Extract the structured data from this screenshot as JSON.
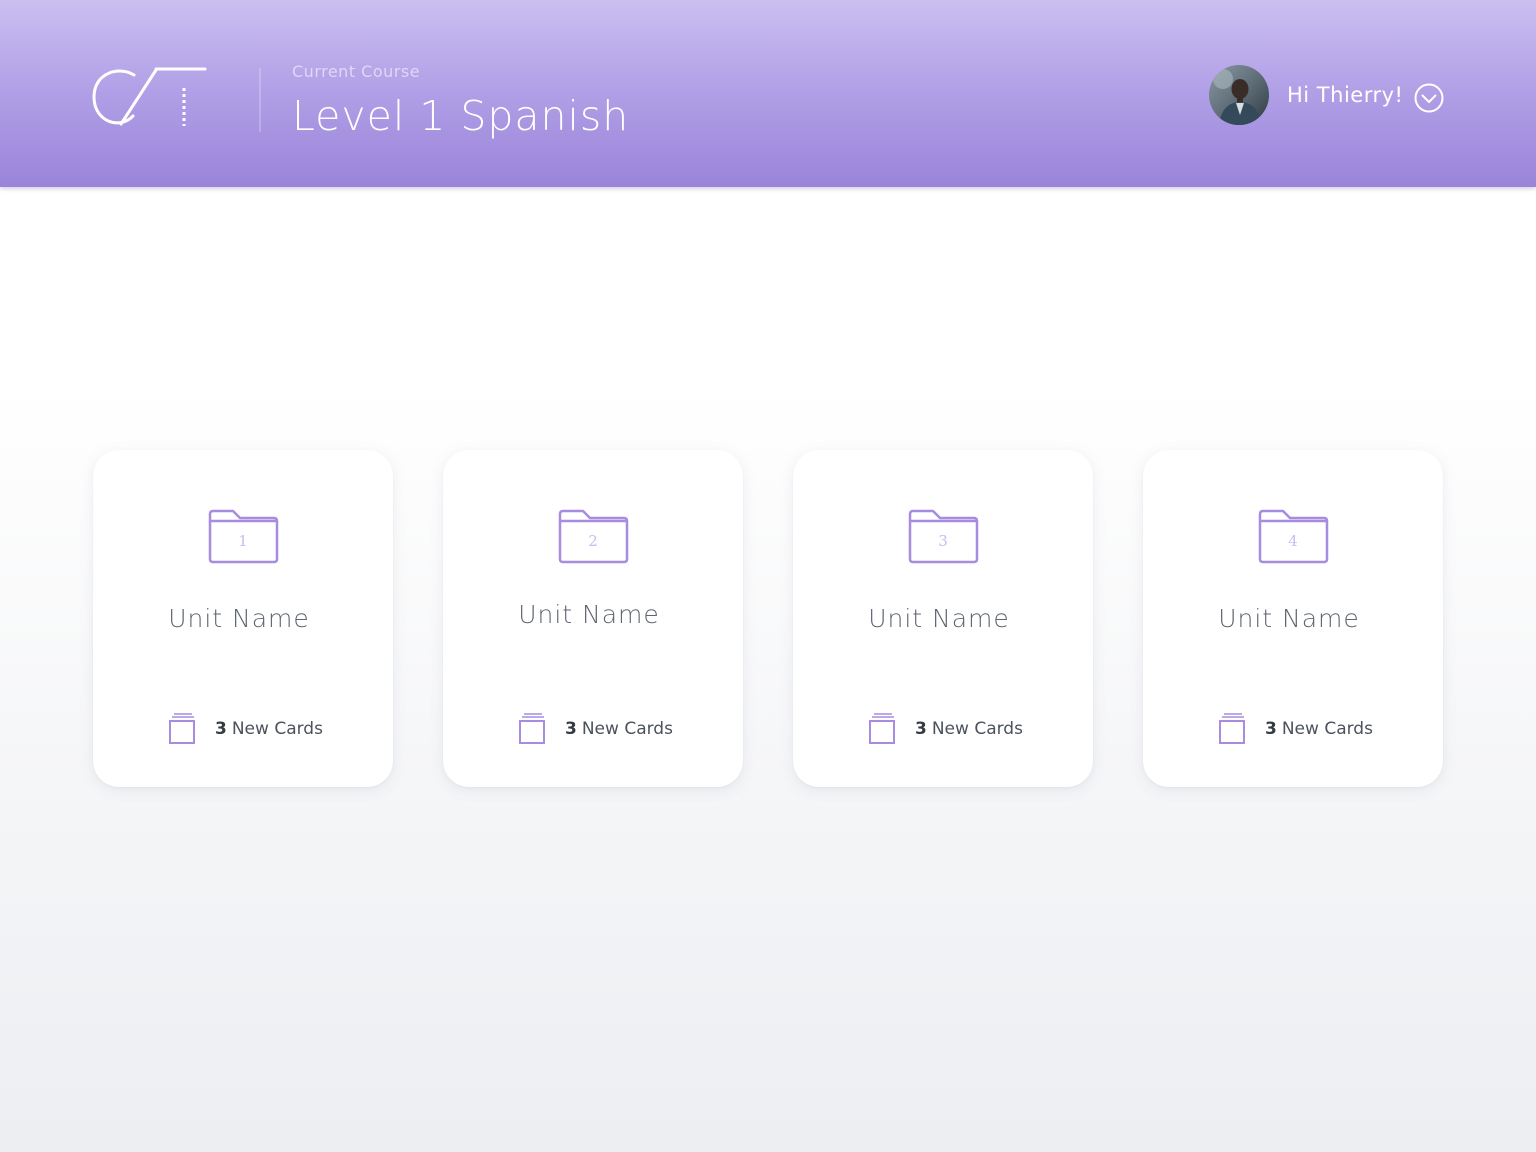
{
  "header": {
    "logo_icon": "ct-logo-icon",
    "course_caption": "Current Course",
    "course_title": "Level 1 Spanish",
    "user": {
      "avatar_icon": "user-avatar",
      "greeting": "Hi Thierry!",
      "menu_icon": "chevron-down-circle-icon"
    }
  },
  "units": [
    {
      "number": "1",
      "name": "Unit Name",
      "new_count": "3",
      "new_label": "New Cards"
    },
    {
      "number": "2",
      "name": "Unit Name",
      "new_count": "3",
      "new_label": "New Cards"
    },
    {
      "number": "3",
      "name": "Unit Name",
      "new_count": "3",
      "new_label": "New Cards"
    },
    {
      "number": "4",
      "name": "Unit Name",
      "new_count": "3",
      "new_label": "New Cards"
    }
  ],
  "colors": {
    "header_gradient_top": "#cbbff0",
    "header_gradient_bottom": "#9a84d9",
    "accent_purple": "#a78ce0",
    "folder_number": "#c6bdee",
    "unit_name_text": "#5e6570",
    "card_background": "#ffffff"
  }
}
